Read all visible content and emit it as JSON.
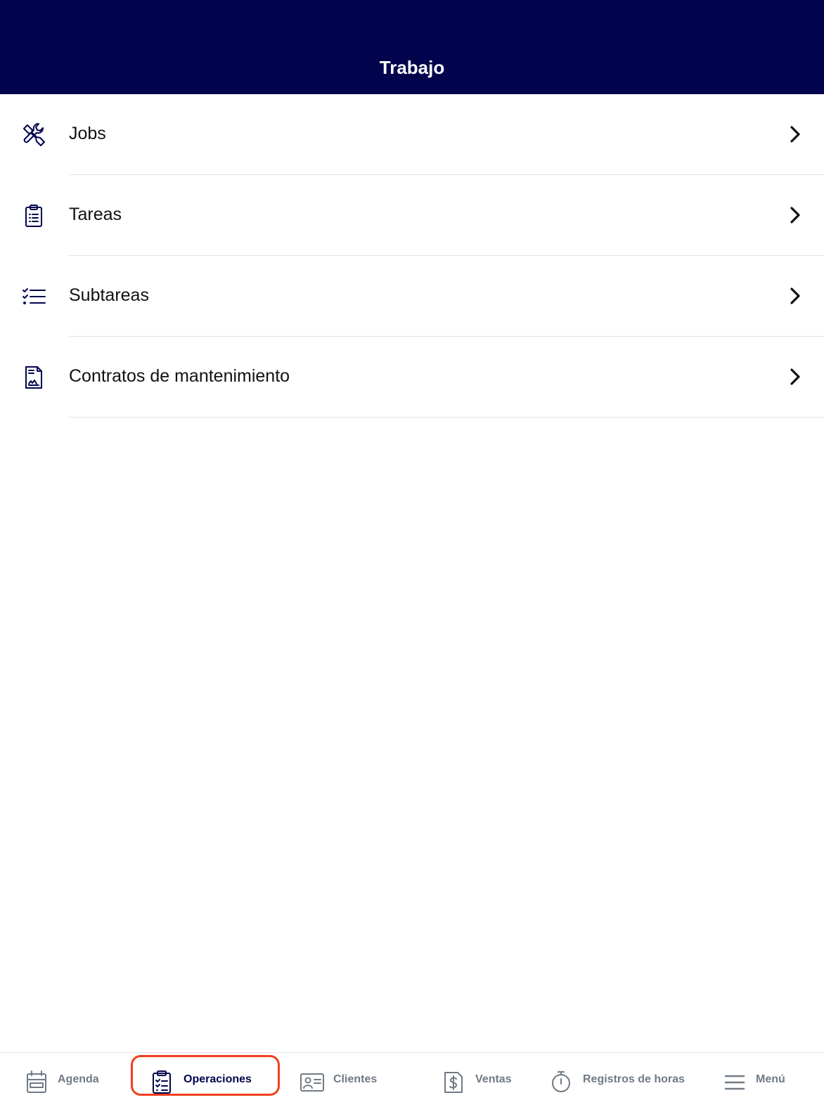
{
  "header": {
    "title": "Trabajo"
  },
  "colors": {
    "header_bg": "#01044d",
    "icon_navy": "#01044d",
    "tab_inactive": "#707a86",
    "highlight": "#f0401f"
  },
  "menu": {
    "items": [
      {
        "label": "Jobs",
        "icon": "tools-icon"
      },
      {
        "label": "Tareas",
        "icon": "clipboard-list-icon"
      },
      {
        "label": "Subtareas",
        "icon": "checklist-icon"
      },
      {
        "label": "Contratos de mantenimiento",
        "icon": "contract-document-icon"
      }
    ]
  },
  "tabbar": {
    "items": [
      {
        "label": "Agenda",
        "icon": "calendar-icon",
        "active": false
      },
      {
        "label": "Operaciones",
        "icon": "clipboard-check-icon",
        "active": true
      },
      {
        "label": "Clientes",
        "icon": "contact-card-icon",
        "active": false
      },
      {
        "label": "Ventas",
        "icon": "dollar-document-icon",
        "active": false
      },
      {
        "label": "Registros de horas",
        "icon": "stopwatch-icon",
        "active": false
      },
      {
        "label": "Menú",
        "icon": "hamburger-menu-icon",
        "active": false
      }
    ]
  }
}
